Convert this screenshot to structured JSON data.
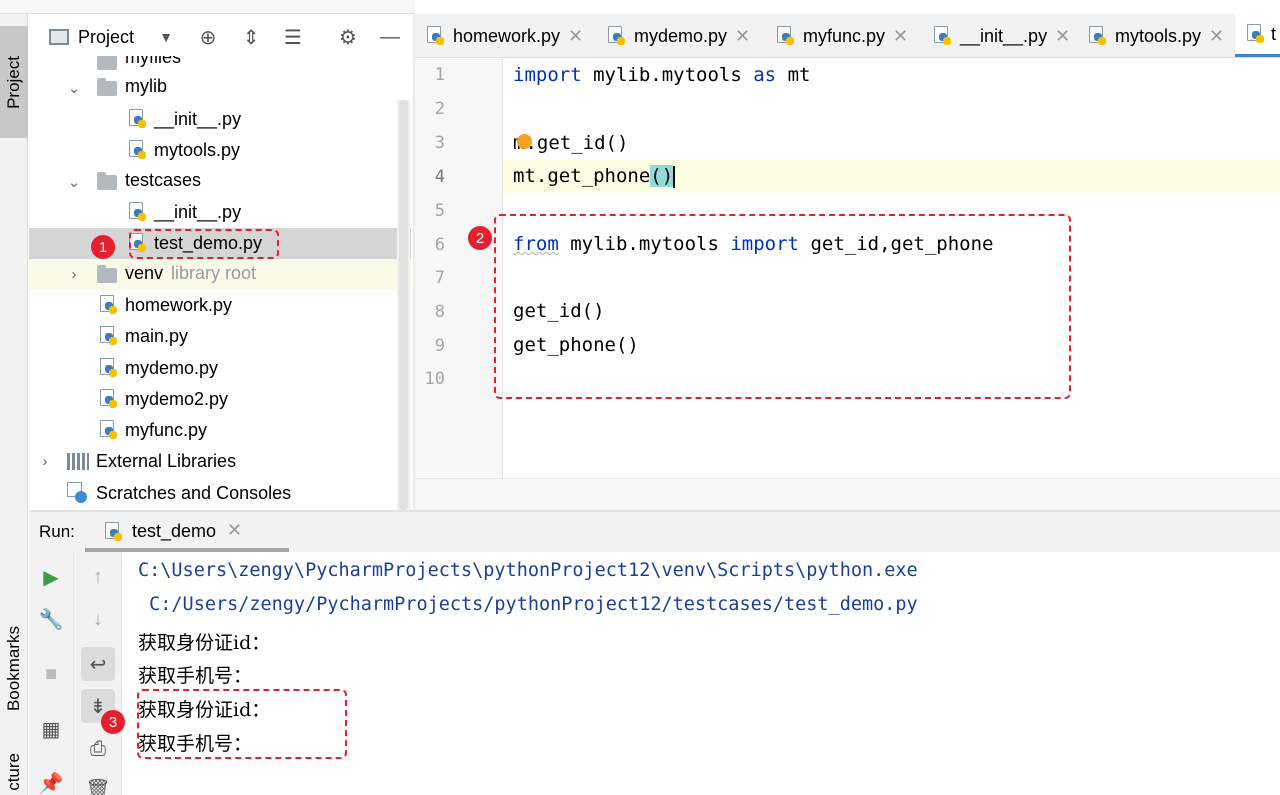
{
  "left_stripe": {
    "project_tab": "Project",
    "bookmarks_tab": "Bookmarks",
    "structure_tab": "cture"
  },
  "project_panel": {
    "title": "Project",
    "tree": [
      {
        "label": "myfiles",
        "kind": "folder"
      },
      {
        "label": "mylib",
        "kind": "folder"
      },
      {
        "label": "__init__.py",
        "kind": "py"
      },
      {
        "label": "mytools.py",
        "kind": "py"
      },
      {
        "label": "testcases",
        "kind": "folder"
      },
      {
        "label": "__init__.py",
        "kind": "py"
      },
      {
        "label": "test_demo.py",
        "kind": "py"
      },
      {
        "label": "venv",
        "kind": "folder",
        "suffix": "library root"
      },
      {
        "label": "homework.py",
        "kind": "py"
      },
      {
        "label": "main.py",
        "kind": "py"
      },
      {
        "label": "mydemo.py",
        "kind": "py"
      },
      {
        "label": "mydemo2.py",
        "kind": "py"
      },
      {
        "label": "myfunc.py",
        "kind": "py"
      },
      {
        "label": "External Libraries",
        "kind": "libraries"
      },
      {
        "label": "Scratches and Consoles",
        "kind": "scratches"
      }
    ]
  },
  "editor_tabs": [
    {
      "label": "homework.py"
    },
    {
      "label": "mydemo.py"
    },
    {
      "label": "myfunc.py"
    },
    {
      "label": "__init__.py"
    },
    {
      "label": "mytools.py"
    },
    {
      "label": "t"
    }
  ],
  "editor": {
    "line_numbers": [
      "1",
      "2",
      "3",
      "4",
      "5",
      "6",
      "7",
      "8",
      "9",
      "10"
    ],
    "line1": {
      "kw1": "import",
      "mid": " mylib.mytools ",
      "kw2": "as",
      "end": " mt"
    },
    "line3": {
      "pre": "m",
      "post": ".get_id()"
    },
    "line4": {
      "pre": "mt.get_phone",
      "brace": "()"
    },
    "line6": {
      "kw1": "from",
      "mid": " mylib.mytools ",
      "kw2": "import",
      "end": " get_id,get_phone"
    },
    "line8": "get_id()",
    "line9": "get_phone()"
  },
  "annotations": {
    "badge1": "1",
    "badge2": "2",
    "badge3": "3"
  },
  "run_panel": {
    "title": "Run:",
    "tab_label": "test_demo",
    "console": [
      "C:\\Users\\zengy\\PycharmProjects\\pythonProject12\\venv\\Scripts\\python.exe",
      " C:/Users/zengy/PycharmProjects/pythonProject12/testcases/test_demo.py",
      "获取身份证id：",
      "获取手机号：",
      "获取身份证id：",
      "获取手机号："
    ]
  },
  "colors": {
    "keyword": "#0033b3",
    "annotation_red": "#e5202e",
    "console_path": "#1a3f95",
    "brace_highlight": "#93d9d9"
  }
}
